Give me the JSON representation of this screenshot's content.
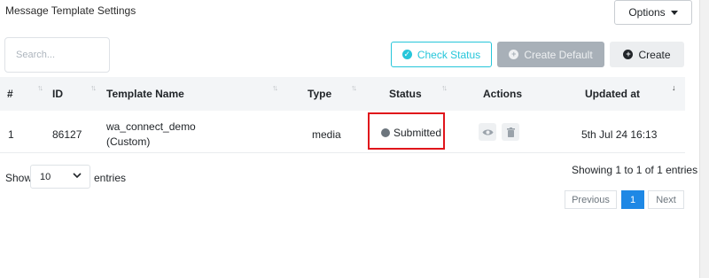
{
  "header": {
    "title": "Message Template Settings",
    "options_label": "Options"
  },
  "toolbar": {
    "search_placeholder": "Search...",
    "check_status_label": "Check Status",
    "create_default_label": "Create Default",
    "create_label": "Create"
  },
  "table": {
    "columns": [
      "#",
      "ID",
      "Template Name",
      "Type",
      "Status",
      "Actions",
      "Updated at"
    ],
    "rows": [
      {
        "index": "1",
        "id": "86127",
        "template_name": "wa_connect_demo",
        "template_subtitle": "(Custom)",
        "type": "media",
        "status": "Submitted",
        "updated_at": "5th Jul 24 16:13"
      }
    ]
  },
  "footer": {
    "show_label": "Show",
    "entries_value": "10",
    "entries_label": "entries",
    "showing_text": "Showing 1 to 1 of 1 entries",
    "pagination": {
      "previous": "Previous",
      "current": "1",
      "next": "Next"
    }
  },
  "colors": {
    "accent": "#26c6da",
    "highlight_box": "#e0151b",
    "page_active": "#1e88e5",
    "status_dot": "#6c757d"
  }
}
